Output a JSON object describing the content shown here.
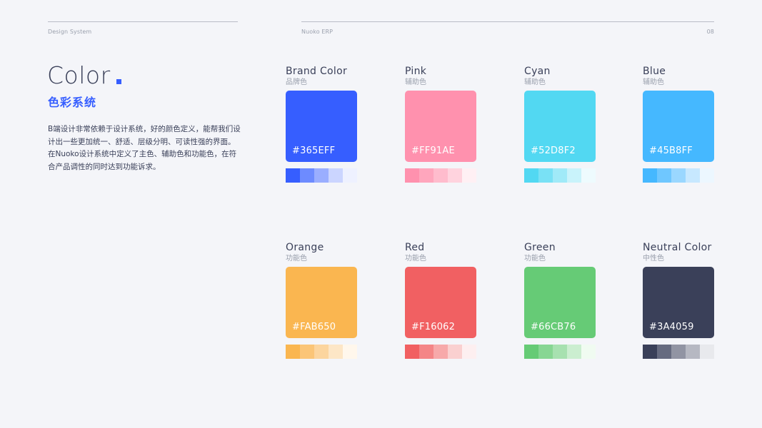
{
  "header": {
    "left": "Design System",
    "middle": "Nuoko ERP",
    "page": "08"
  },
  "section": {
    "title": "Color",
    "subtitle": "色彩系统",
    "description": [
      "B端设计非常依赖于设计系统，好的颜色定义，能帮我们设",
      "计出一些更加统一、舒适、层级分明、可读性强的界面。",
      "在Nuoko设计系统中定义了主色、辅助色和功能色，在符",
      "合产品调性的同时达到功能诉求。"
    ]
  },
  "accent": "#365eff",
  "colors": [
    {
      "name": "Brand Color",
      "category": "品牌色",
      "hex": "#365EFF",
      "color": "#365eff",
      "scale": [
        "#365eff",
        "#6d8bff",
        "#9aaeff",
        "#cbd5ff",
        "#eef1ff"
      ]
    },
    {
      "name": "Pink",
      "category": "辅助色",
      "hex": "#FF91AE",
      "color": "#ff91ae",
      "scale": [
        "#ff91ae",
        "#ffa6bd",
        "#ffbccd",
        "#ffd3de",
        "#fff0f4"
      ]
    },
    {
      "name": "Cyan",
      "category": "辅助色",
      "hex": "#52D8F2",
      "color": "#52d8f2",
      "scale": [
        "#52d8f2",
        "#79e1f5",
        "#a0eaf8",
        "#c9f3fb",
        "#eefbfe"
      ]
    },
    {
      "name": "Blue",
      "category": "辅助色",
      "hex": "#45B8FF",
      "color": "#45b8ff",
      "scale": [
        "#45b8ff",
        "#6fc7ff",
        "#9ad7ff",
        "#c7e8ff",
        "#ecf7ff"
      ]
    },
    {
      "name": "Orange",
      "category": "功能色",
      "hex": "#FAB650",
      "color": "#fab650",
      "scale": [
        "#fab650",
        "#fbc577",
        "#fcd59e",
        "#fde6c6",
        "#fff7ec"
      ]
    },
    {
      "name": "Red",
      "category": "功能色",
      "hex": "#F16062",
      "color": "#f16062",
      "scale": [
        "#f16062",
        "#f48587",
        "#f7a9aa",
        "#fad0d0",
        "#fdeff0"
      ]
    },
    {
      "name": "Green",
      "category": "功能色",
      "hex": "#66CB76",
      "color": "#66cb76",
      "scale": [
        "#66cb76",
        "#87d693",
        "#a7e1b0",
        "#cbeed0",
        "#f0fbf1"
      ]
    },
    {
      "name": "Neutral Color",
      "category": "中性色",
      "hex": "#3A4059",
      "color": "#3a4059",
      "scale": [
        "#3a4059",
        "#666b80",
        "#9194a3",
        "#b6b8c2",
        "#e8e9ed"
      ]
    }
  ]
}
